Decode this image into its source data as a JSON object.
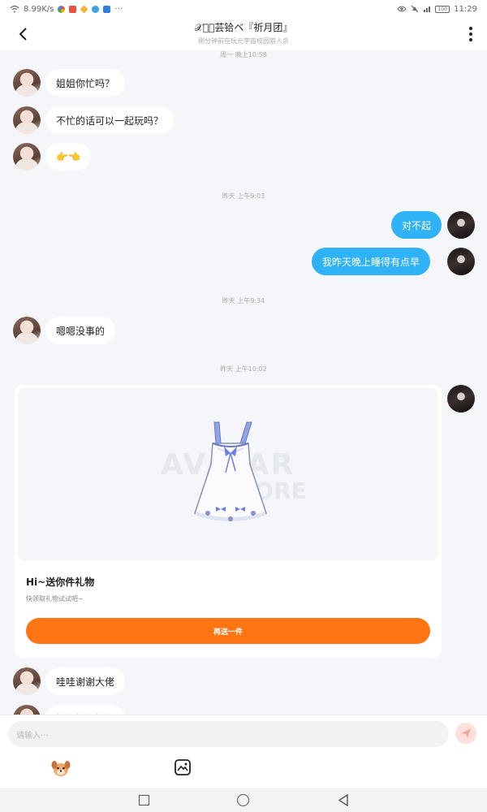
{
  "status_bar": {
    "speed": "8.99K/s",
    "time": "11:29",
    "battery": "100"
  },
  "header": {
    "title": "𝒳𝓇゙芸铪ベ『祈月团』",
    "subtitle": "刚分钟前在玩元宇宙校园狼人杀"
  },
  "messages": [
    {
      "type": "time",
      "text": "周一 晚上10:58"
    },
    {
      "type": "in",
      "text": "姐姐你忙吗？"
    },
    {
      "type": "in",
      "text": "不忙的话可以一起玩吗？"
    },
    {
      "type": "in",
      "text": "👉👈"
    },
    {
      "type": "time",
      "text": "昨天 上午9:03"
    },
    {
      "type": "out",
      "text": "对不起"
    },
    {
      "type": "out",
      "text": "我昨天晚上睡得有点早"
    },
    {
      "type": "time",
      "text": "昨天 上午9:34"
    },
    {
      "type": "in",
      "text": "嗯嗯没事的"
    },
    {
      "type": "time",
      "text": "昨天 上午10:02"
    },
    {
      "type": "in",
      "text": "哇哇谢谢大佬"
    },
    {
      "type": "in",
      "text": "抱抱抱抱抱抱"
    }
  ],
  "gift_card": {
    "watermark_top": "AVATAR",
    "watermark_bottom": "STORE",
    "title": "Hi~送你件礼物",
    "subtitle": "快领取礼物试试吧~",
    "button_label": "再送一件"
  },
  "input": {
    "placeholder": "请输入···"
  },
  "colors": {
    "accent_blue": "#30b2f6",
    "accent_orange": "#ff7514"
  }
}
